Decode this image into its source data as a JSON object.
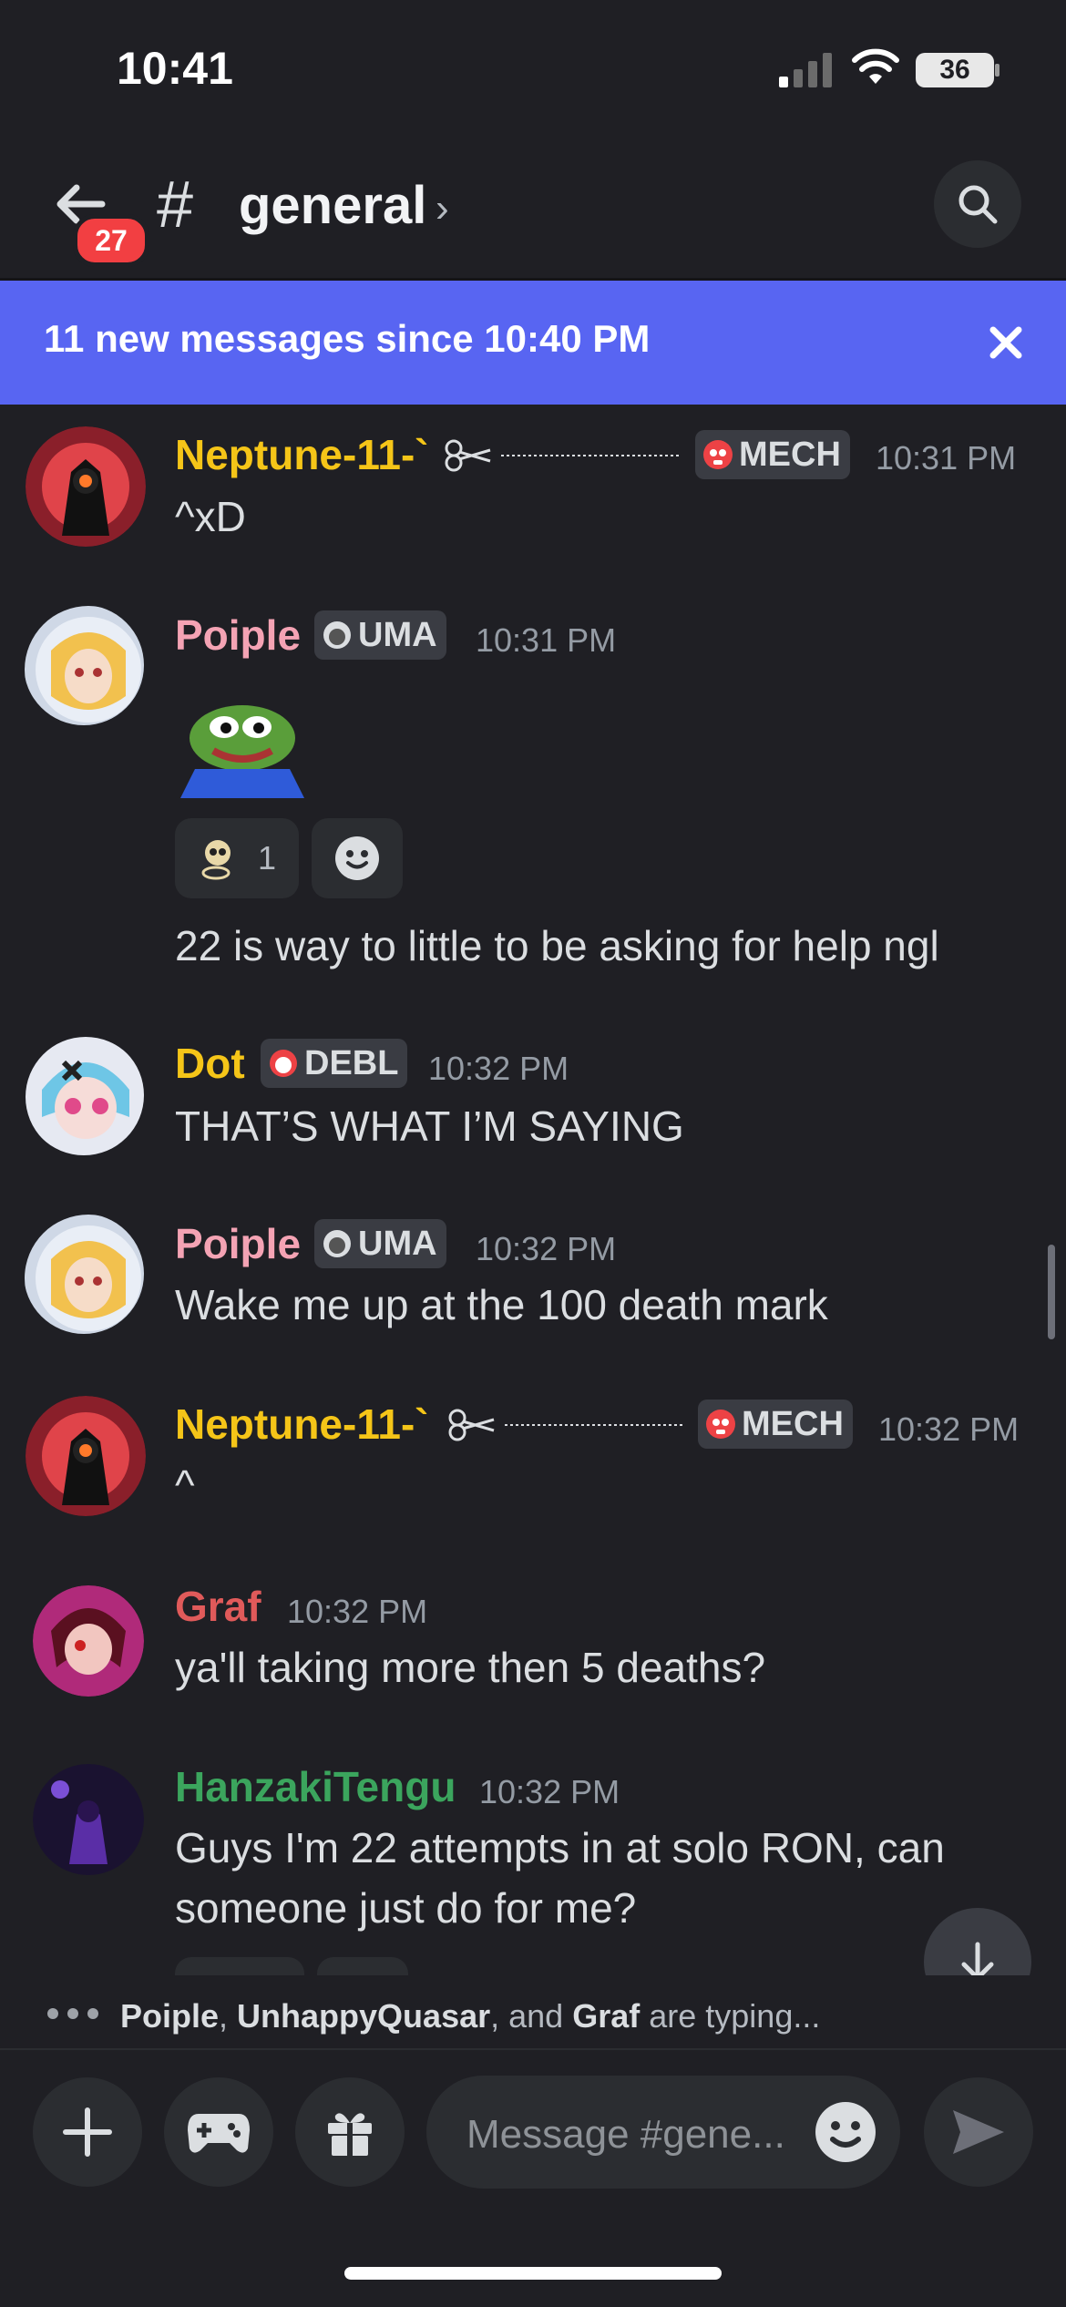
{
  "status_bar": {
    "time": "10:41",
    "battery": "36"
  },
  "header": {
    "unread_count": "27",
    "channel_name": "general",
    "hash": "#",
    "chevron": "›"
  },
  "banner": {
    "text": "11 new messages since 10:40 PM"
  },
  "messages": [
    {
      "user": "Neptune-11-`",
      "tag": "MECH",
      "time": "10:31 PM",
      "text": "^xD"
    },
    {
      "user": "Poiple",
      "tag": "UMA",
      "time": "10:31 PM",
      "reaction_count": "1",
      "text": "22 is way to little to be asking for help ngl"
    },
    {
      "user": "Dot",
      "tag": "DEBL",
      "time": "10:32 PM",
      "text": "THAT’S WHAT I’M SAYING"
    },
    {
      "user": "Poiple",
      "tag": "UMA",
      "time": "10:32 PM",
      "text": "Wake me up at the 100 death mark"
    },
    {
      "user": "Neptune-11-`",
      "tag": "MECH",
      "time": "10:32 PM",
      "text": "^"
    },
    {
      "user": "Graf",
      "time": "10:32 PM",
      "text": "ya'll taking more then 5 deaths?"
    },
    {
      "user": "HanzakiTengu",
      "time": "10:32 PM",
      "text_line1": "Guys I'm 22 attempts in at solo RON, can",
      "text_line2": "someone just do for me?"
    }
  ],
  "typing": {
    "user1": "Poiple",
    "sep1": ", ",
    "user2": "UnhappyQuasar",
    "sep2": ", and ",
    "user3": "Graf",
    "suffix": " are typing..."
  },
  "composer": {
    "placeholder": "Message #gene..."
  },
  "colors": {
    "accent": "#5865f2",
    "badge": "#f23f42",
    "background": "#1f1f24"
  }
}
